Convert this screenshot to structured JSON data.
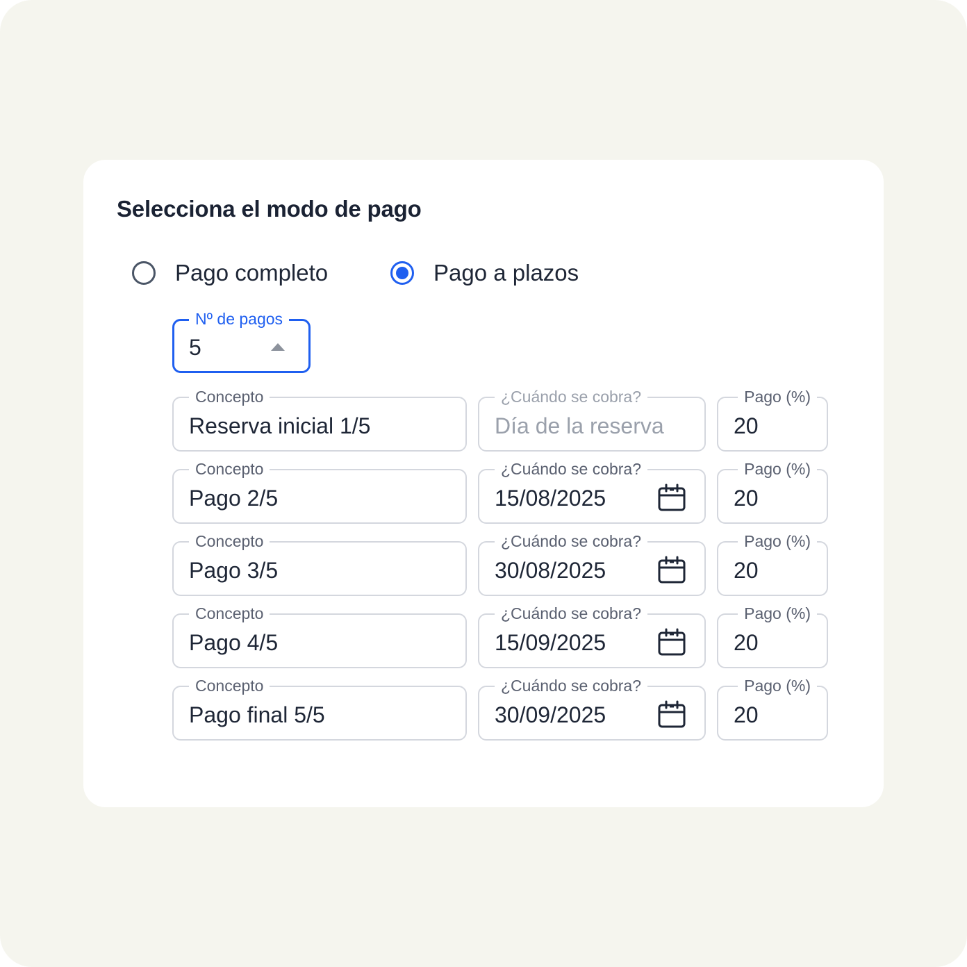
{
  "form": {
    "title": "Selecciona el modo de pago",
    "payment_modes": [
      {
        "label": "Pago completo",
        "selected": false
      },
      {
        "label": "Pago a plazos",
        "selected": true
      }
    ],
    "num_payments": {
      "label": "Nº de pagos",
      "value": "5"
    },
    "installments": [
      {
        "concept_label": "Concepto",
        "concept": "Reserva inicial 1/5",
        "date_label": "¿Cuándo se cobra?",
        "date": "Día de la reserva",
        "date_is_placeholder": true,
        "date_icon": "",
        "percent_label": "Pago (%)",
        "percent": "20"
      },
      {
        "concept_label": "Concepto",
        "concept": "Pago 2/5",
        "date_label": "¿Cuándo se cobra?",
        "date": "15/08/2025",
        "date_is_placeholder": false,
        "date_icon": "calendar-icon",
        "percent_label": "Pago (%)",
        "percent": "20"
      },
      {
        "concept_label": "Concepto",
        "concept": "Pago 3/5",
        "date_label": "¿Cuándo se cobra?",
        "date": "30/08/2025",
        "date_is_placeholder": false,
        "date_icon": "calendar-icon",
        "percent_label": "Pago (%)",
        "percent": "20"
      },
      {
        "concept_label": "Concepto",
        "concept": "Pago 4/5",
        "date_label": "¿Cuándo se cobra?",
        "date": "15/09/2025",
        "date_is_placeholder": false,
        "date_icon": "calendar-icon",
        "percent_label": "Pago (%)",
        "percent": "20"
      },
      {
        "concept_label": "Concepto",
        "concept": "Pago final 5/5",
        "date_label": "¿Cuándo se cobra?",
        "date": "30/09/2025",
        "date_is_placeholder": false,
        "date_icon": "calendar-icon",
        "percent_label": "Pago (%)",
        "percent": "20"
      }
    ]
  },
  "colors": {
    "page_background": "#f5f5ee",
    "card_background": "#ffffff",
    "accent": "#1f5ff0",
    "text": "#1e2636",
    "muted_text": "#9aa0ab",
    "border": "#d4d7de"
  },
  "stepper_icon": "caret-up-icon"
}
